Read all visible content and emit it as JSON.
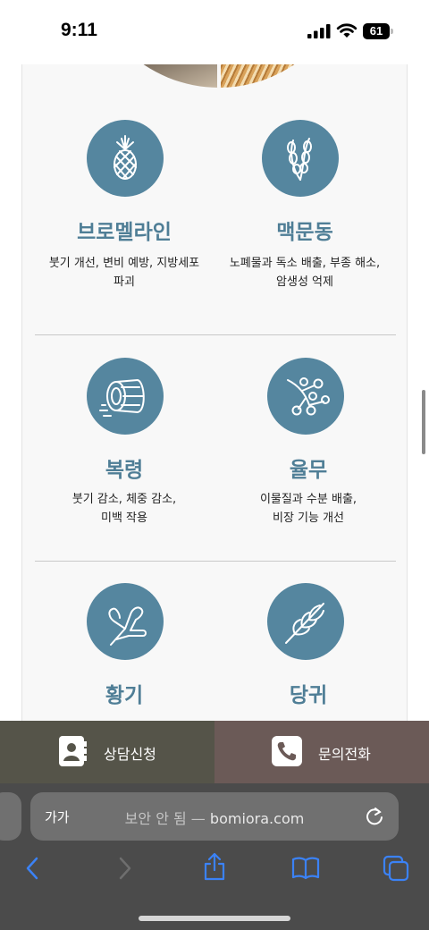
{
  "status_bar": {
    "time": "9:11",
    "battery": "61"
  },
  "items": [
    {
      "title": "브로멜라인",
      "desc_line1": "붓기 개선, 변비 예방, 지방세포",
      "desc_line2": "파괴",
      "icon": "pineapple-icon"
    },
    {
      "title": "맥문동",
      "desc_line1": "노폐물과 독소 배출, 부종 해소,",
      "desc_line2": "암생성 억제",
      "icon": "grain-stalk-icon"
    },
    {
      "title": "복령",
      "desc_line1": "붓기 감소, 체중 감소,",
      "desc_line2": "미백 작용",
      "icon": "log-slice-icon"
    },
    {
      "title": "율무",
      "desc_line1": "이물질과 수분 배출,",
      "desc_line2": "비장 기능 개선",
      "icon": "berries-icon"
    },
    {
      "title": "황기",
      "desc_line1": "",
      "desc_line2": "",
      "icon": "root-icon"
    },
    {
      "title": "당귀",
      "desc_line1": "",
      "desc_line2": "",
      "icon": "leaf-icon"
    }
  ],
  "cta": {
    "consult_label": "상담신청",
    "call_label": "문의전화"
  },
  "safari": {
    "aa_label": "가가",
    "insecure_label": "보안 안 됨 —",
    "domain": "bomiora.com"
  },
  "colors": {
    "accent": "#55869f",
    "title": "#4f7e96",
    "cta_left": "#555449",
    "cta_right": "#6b5a57",
    "toolbar": "#4b4b4b",
    "safari_blue": "#3b82f6"
  }
}
